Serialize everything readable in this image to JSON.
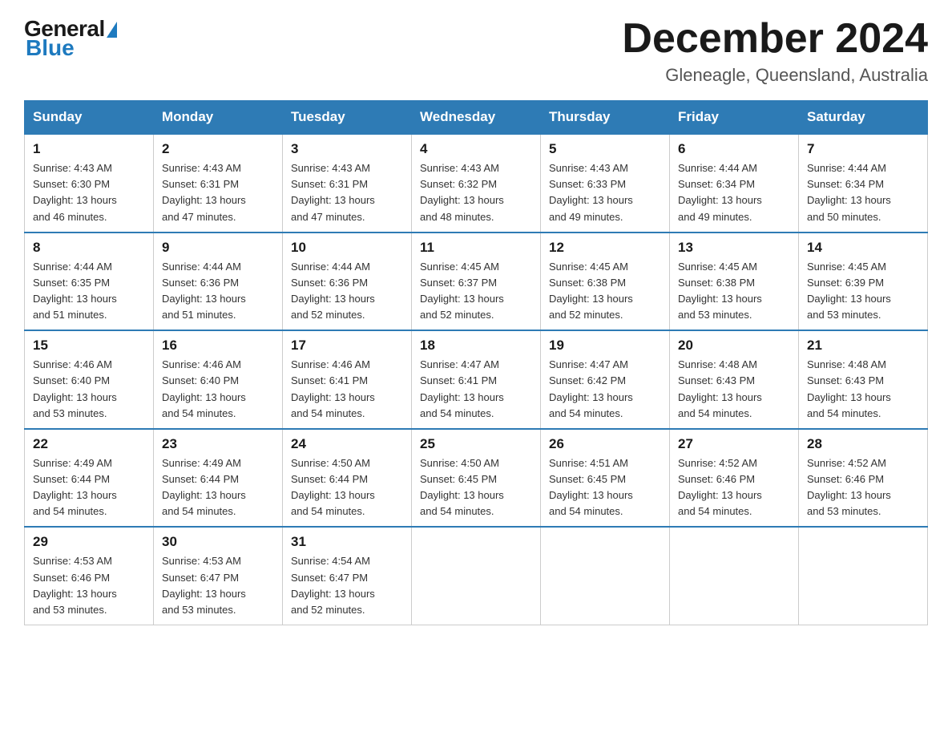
{
  "header": {
    "logo_general": "General",
    "logo_blue": "Blue",
    "title": "December 2024",
    "subtitle": "Gleneagle, Queensland, Australia"
  },
  "days_of_week": [
    "Sunday",
    "Monday",
    "Tuesday",
    "Wednesday",
    "Thursday",
    "Friday",
    "Saturday"
  ],
  "weeks": [
    [
      {
        "day": "1",
        "sunrise": "4:43 AM",
        "sunset": "6:30 PM",
        "daylight": "13 hours and 46 minutes."
      },
      {
        "day": "2",
        "sunrise": "4:43 AM",
        "sunset": "6:31 PM",
        "daylight": "13 hours and 47 minutes."
      },
      {
        "day": "3",
        "sunrise": "4:43 AM",
        "sunset": "6:31 PM",
        "daylight": "13 hours and 47 minutes."
      },
      {
        "day": "4",
        "sunrise": "4:43 AM",
        "sunset": "6:32 PM",
        "daylight": "13 hours and 48 minutes."
      },
      {
        "day": "5",
        "sunrise": "4:43 AM",
        "sunset": "6:33 PM",
        "daylight": "13 hours and 49 minutes."
      },
      {
        "day": "6",
        "sunrise": "4:44 AM",
        "sunset": "6:34 PM",
        "daylight": "13 hours and 49 minutes."
      },
      {
        "day": "7",
        "sunrise": "4:44 AM",
        "sunset": "6:34 PM",
        "daylight": "13 hours and 50 minutes."
      }
    ],
    [
      {
        "day": "8",
        "sunrise": "4:44 AM",
        "sunset": "6:35 PM",
        "daylight": "13 hours and 51 minutes."
      },
      {
        "day": "9",
        "sunrise": "4:44 AM",
        "sunset": "6:36 PM",
        "daylight": "13 hours and 51 minutes."
      },
      {
        "day": "10",
        "sunrise": "4:44 AM",
        "sunset": "6:36 PM",
        "daylight": "13 hours and 52 minutes."
      },
      {
        "day": "11",
        "sunrise": "4:45 AM",
        "sunset": "6:37 PM",
        "daylight": "13 hours and 52 minutes."
      },
      {
        "day": "12",
        "sunrise": "4:45 AM",
        "sunset": "6:38 PM",
        "daylight": "13 hours and 52 minutes."
      },
      {
        "day": "13",
        "sunrise": "4:45 AM",
        "sunset": "6:38 PM",
        "daylight": "13 hours and 53 minutes."
      },
      {
        "day": "14",
        "sunrise": "4:45 AM",
        "sunset": "6:39 PM",
        "daylight": "13 hours and 53 minutes."
      }
    ],
    [
      {
        "day": "15",
        "sunrise": "4:46 AM",
        "sunset": "6:40 PM",
        "daylight": "13 hours and 53 minutes."
      },
      {
        "day": "16",
        "sunrise": "4:46 AM",
        "sunset": "6:40 PM",
        "daylight": "13 hours and 54 minutes."
      },
      {
        "day": "17",
        "sunrise": "4:46 AM",
        "sunset": "6:41 PM",
        "daylight": "13 hours and 54 minutes."
      },
      {
        "day": "18",
        "sunrise": "4:47 AM",
        "sunset": "6:41 PM",
        "daylight": "13 hours and 54 minutes."
      },
      {
        "day": "19",
        "sunrise": "4:47 AM",
        "sunset": "6:42 PM",
        "daylight": "13 hours and 54 minutes."
      },
      {
        "day": "20",
        "sunrise": "4:48 AM",
        "sunset": "6:43 PM",
        "daylight": "13 hours and 54 minutes."
      },
      {
        "day": "21",
        "sunrise": "4:48 AM",
        "sunset": "6:43 PM",
        "daylight": "13 hours and 54 minutes."
      }
    ],
    [
      {
        "day": "22",
        "sunrise": "4:49 AM",
        "sunset": "6:44 PM",
        "daylight": "13 hours and 54 minutes."
      },
      {
        "day": "23",
        "sunrise": "4:49 AM",
        "sunset": "6:44 PM",
        "daylight": "13 hours and 54 minutes."
      },
      {
        "day": "24",
        "sunrise": "4:50 AM",
        "sunset": "6:44 PM",
        "daylight": "13 hours and 54 minutes."
      },
      {
        "day": "25",
        "sunrise": "4:50 AM",
        "sunset": "6:45 PM",
        "daylight": "13 hours and 54 minutes."
      },
      {
        "day": "26",
        "sunrise": "4:51 AM",
        "sunset": "6:45 PM",
        "daylight": "13 hours and 54 minutes."
      },
      {
        "day": "27",
        "sunrise": "4:52 AM",
        "sunset": "6:46 PM",
        "daylight": "13 hours and 54 minutes."
      },
      {
        "day": "28",
        "sunrise": "4:52 AM",
        "sunset": "6:46 PM",
        "daylight": "13 hours and 53 minutes."
      }
    ],
    [
      {
        "day": "29",
        "sunrise": "4:53 AM",
        "sunset": "6:46 PM",
        "daylight": "13 hours and 53 minutes."
      },
      {
        "day": "30",
        "sunrise": "4:53 AM",
        "sunset": "6:47 PM",
        "daylight": "13 hours and 53 minutes."
      },
      {
        "day": "31",
        "sunrise": "4:54 AM",
        "sunset": "6:47 PM",
        "daylight": "13 hours and 52 minutes."
      },
      null,
      null,
      null,
      null
    ]
  ],
  "labels": {
    "sunrise": "Sunrise:",
    "sunset": "Sunset:",
    "daylight": "Daylight:"
  }
}
